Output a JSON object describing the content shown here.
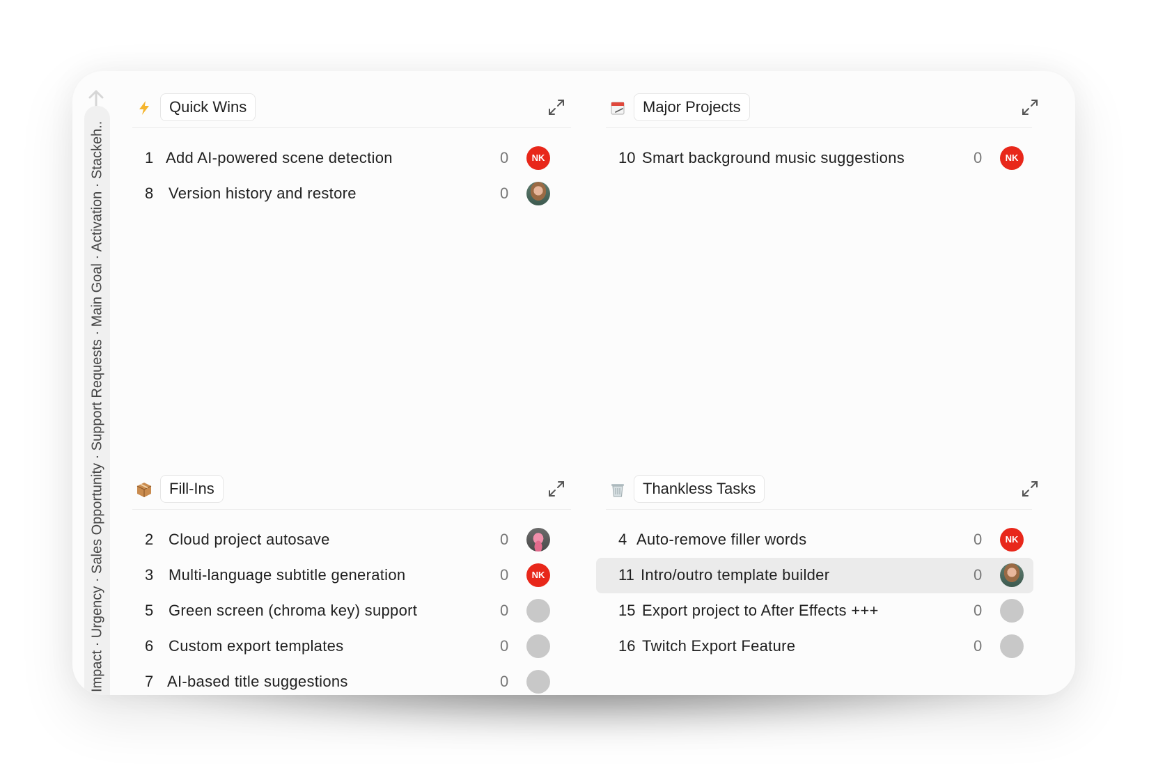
{
  "axis": {
    "label": "Impact · Urgency · Sales Opportunity · Support Requests · Main Goal · Activation · Stackeh..."
  },
  "quadrants": [
    {
      "title": "Quick Wins",
      "icon": "lightning-icon",
      "items": [
        {
          "num": "1",
          "title": "Add AI-powered scene detection",
          "count": "0",
          "avatar": "NK"
        },
        {
          "num": "8",
          "title": "Version history and restore",
          "count": "0",
          "avatar": "photo"
        }
      ]
    },
    {
      "title": "Major Projects",
      "icon": "calendar-icon",
      "items": [
        {
          "num": "10",
          "title": "Smart background music suggestions",
          "count": "0",
          "avatar": "NK"
        }
      ]
    },
    {
      "title": "Fill-Ins",
      "icon": "package-icon",
      "items": [
        {
          "num": "2",
          "title": "Cloud project autosave",
          "count": "0",
          "avatar": "photo"
        },
        {
          "num": "3",
          "title": "Multi-language subtitle generation",
          "count": "0",
          "avatar": "NK"
        },
        {
          "num": "5",
          "title": "Green screen (chroma key) support",
          "count": "0",
          "avatar": "empty"
        },
        {
          "num": "6",
          "title": "Custom export templates",
          "count": "0",
          "avatar": "empty"
        },
        {
          "num": "7",
          "title": "AI-based title suggestions",
          "count": "0",
          "avatar": "empty"
        }
      ]
    },
    {
      "title": "Thankless Tasks",
      "icon": "trash-icon",
      "items": [
        {
          "num": "4",
          "title": "Auto-remove filler words",
          "count": "0",
          "avatar": "NK"
        },
        {
          "num": "11",
          "title": "Intro/outro template builder",
          "count": "0",
          "avatar": "photo"
        },
        {
          "num": "15",
          "title": "Export project to After Effects +++",
          "count": "0",
          "avatar": "empty"
        },
        {
          "num": "16",
          "title": "Twitch Export Feature",
          "count": "0",
          "avatar": "empty"
        }
      ]
    }
  ],
  "colors": {
    "avatar_nk": "#e8271a",
    "lightning": "#f5b52e",
    "highlight_row": "#ebebeb"
  }
}
